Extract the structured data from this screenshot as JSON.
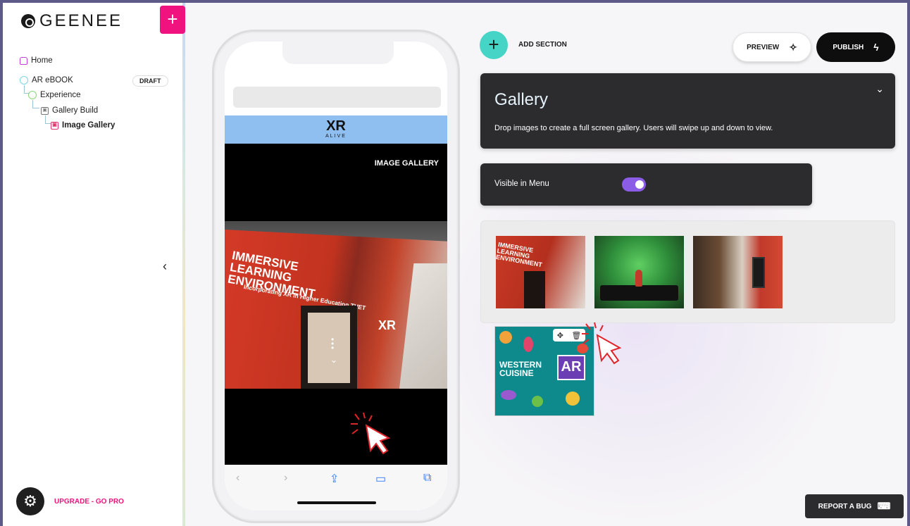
{
  "brand": {
    "logo_text": "GEENEE"
  },
  "sidebar": {
    "add_label": "+",
    "tree": [
      {
        "label": "Home",
        "icon": "home-icon"
      },
      {
        "label": "AR eBOOK",
        "icon": "circle-icon",
        "badge": "DRAFT"
      },
      {
        "label": "Experience",
        "icon": "circle-icon"
      },
      {
        "label": "Gallery Build",
        "icon": "image-icon"
      },
      {
        "label": "Image Gallery",
        "icon": "image-icon"
      }
    ],
    "collapse_icon": "‹",
    "upgrade_label": "UPGRADE - GO PRO"
  },
  "phone": {
    "logo_text": "XR",
    "logo_sub": "ALIVE",
    "screen_title": "IMAGE GALLERY",
    "photo_text": "IMMERSIVE LEARNING ENVIRONMENT",
    "photo_sub": "Incorporating XR in Higher Education TVET",
    "photo_brand": "XR"
  },
  "toolbar": {
    "add_section_label": "ADD SECTION",
    "preview_label": "PREVIEW",
    "publish_label": "PUBLISH"
  },
  "gallery": {
    "title": "Gallery",
    "description": "Drop images to create a full screen gallery. Users will swipe up and down to view.",
    "visible_label": "Visible in Menu",
    "visible": true,
    "thumb1_text": "IMMERSIVE LEARNING ENVIRONMENT",
    "thumb4_text": "WESTERN CUISINE",
    "thumb4_badge": "AR"
  },
  "footer": {
    "report_label": "REPORT A BUG"
  },
  "colors": {
    "accent_pink": "#f0137f",
    "accent_teal": "#45d4c6",
    "toggle_purple": "#8b5ce6",
    "card_dark": "#2c2c2e"
  }
}
